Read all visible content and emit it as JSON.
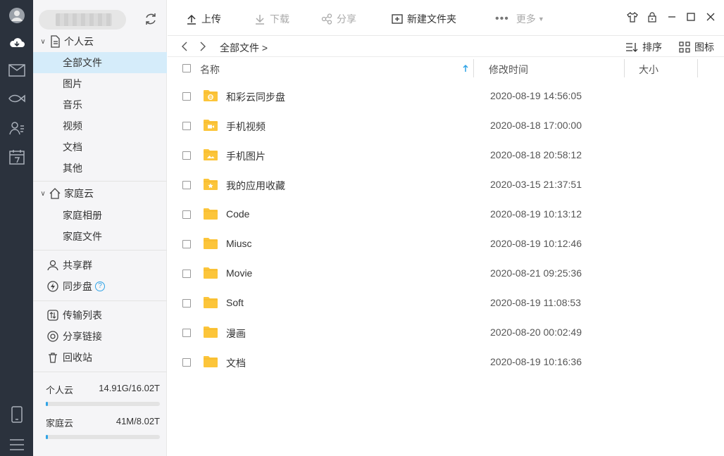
{
  "sidebar": {
    "personal_cloud": {
      "label": "个人云",
      "items": [
        "全部文件",
        "图片",
        "音乐",
        "视频",
        "文档",
        "其他"
      ]
    },
    "family_cloud": {
      "label": "家庭云",
      "items": [
        "家庭相册",
        "家庭文件"
      ]
    },
    "share_group": "共享群",
    "sync_disk": "同步盘",
    "help_mark": "?",
    "transfer_list": "传输列表",
    "share_links": "分享链接",
    "recycle_bin": "回收站",
    "quota": [
      {
        "label": "个人云",
        "value": "14.91G/16.02T",
        "fill_fraction": 0.001
      },
      {
        "label": "家庭云",
        "value": "41M/8.02T",
        "fill_fraction": 0.001
      }
    ]
  },
  "toolbar": {
    "upload": "上传",
    "download": "下载",
    "share": "分享",
    "new_folder": "新建文件夹",
    "more": "更多"
  },
  "pathbar": {
    "breadcrumb": "全部文件 >",
    "sort": "排序",
    "view": "图标"
  },
  "table": {
    "col_name": "名称",
    "col_modified": "修改时间",
    "col_size": "大小",
    "rows": [
      {
        "name": "和彩云同步盘",
        "modified": "2020-08-19 14:56:05",
        "icon": "sync-folder-icon"
      },
      {
        "name": "手机视频",
        "modified": "2020-08-18 17:00:00",
        "icon": "video-folder-icon"
      },
      {
        "name": "手机图片",
        "modified": "2020-08-18 20:58:12",
        "icon": "image-folder-icon"
      },
      {
        "name": "我的应用收藏",
        "modified": "2020-03-15 21:37:51",
        "icon": "star-folder-icon"
      },
      {
        "name": "Code",
        "modified": "2020-08-19 10:13:12",
        "icon": "folder-icon"
      },
      {
        "name": "Miusc",
        "modified": "2020-08-19 10:12:46",
        "icon": "folder-icon"
      },
      {
        "name": "Movie",
        "modified": "2020-08-21 09:25:36",
        "icon": "folder-icon"
      },
      {
        "name": "Soft",
        "modified": "2020-08-19 11:08:53",
        "icon": "folder-icon"
      },
      {
        "name": "漫画",
        "modified": "2020-08-20 00:02:49",
        "icon": "folder-icon"
      },
      {
        "name": "文档",
        "modified": "2020-08-19 10:16:36",
        "icon": "folder-icon"
      }
    ]
  },
  "colors": {
    "rail": "#2b323d",
    "accent": "#2fa3e6",
    "active_item": "#d5ecfa",
    "folder": "#fcc53a"
  }
}
